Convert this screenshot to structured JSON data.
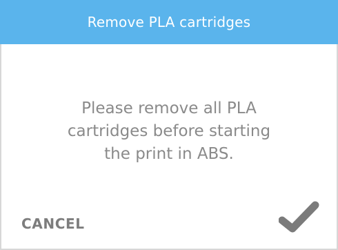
{
  "dialog": {
    "title": "Remove PLA cartridges",
    "message_lines": [
      "Please remove all PLA",
      "cartridges before starting",
      "the print in ABS."
    ],
    "cancel_label": "CANCEL",
    "confirm_icon": "checkmark-icon"
  },
  "colors": {
    "header_bg": "#5ab4ec",
    "header_text": "#ffffff",
    "message_text": "#8a8a8a",
    "action_text": "#7d7d7d",
    "checkmark": "#7b7b7b",
    "border": "#d7d7d7"
  }
}
